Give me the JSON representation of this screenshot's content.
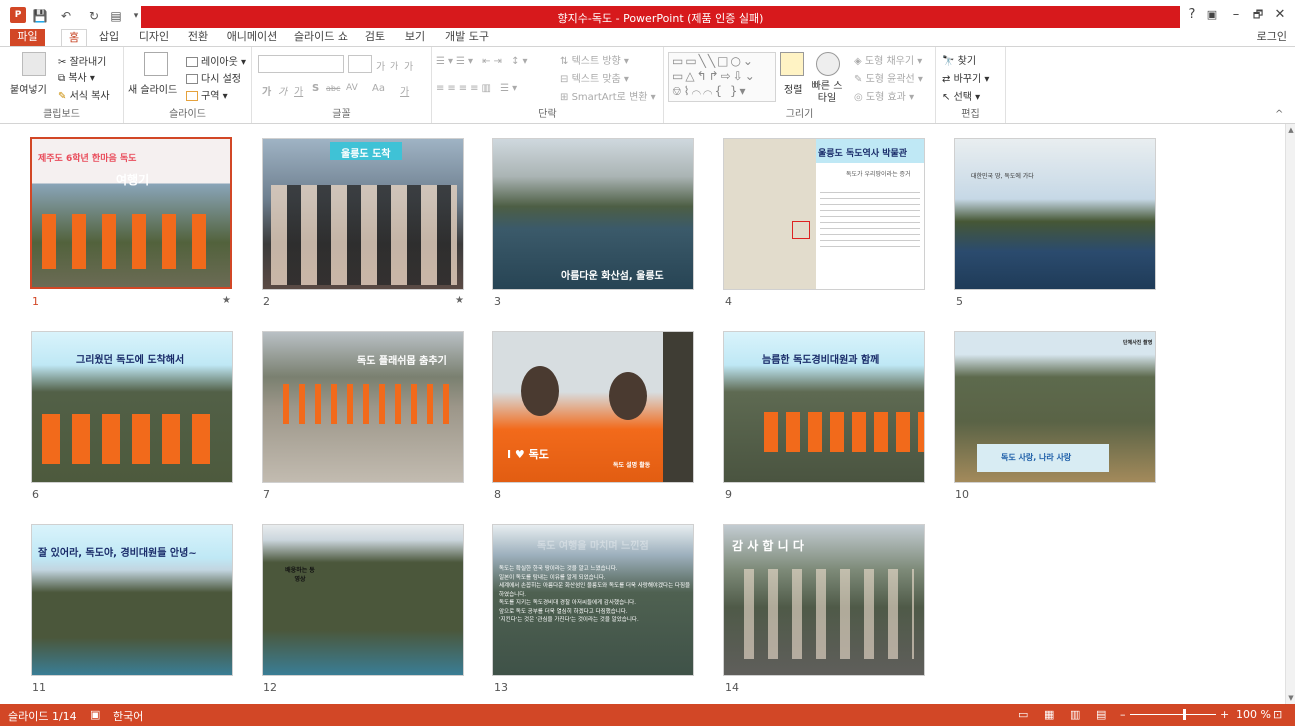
{
  "window": {
    "title": "향지수-독도 - PowerPoint (제품 인증 실패)",
    "help": "?",
    "ribbon_display": "▣",
    "minimize": "–",
    "restore": "🗗",
    "close": "✕"
  },
  "tabs": {
    "file": "파일",
    "home": "홈",
    "insert": "삽입",
    "design": "디자인",
    "transitions": "전환",
    "animations": "애니메이션",
    "slideshow": "슬라이드 쇼",
    "review": "검토",
    "view": "보기",
    "developer": "개발 도구",
    "login": "로그인"
  },
  "ribbon": {
    "clipboard": {
      "paste": "붙여넣기",
      "cut": "잘라내기",
      "copy": "복사",
      "format_painter": "서식 복사",
      "label": "클립보드"
    },
    "slides": {
      "new_slide": "새 슬라이드",
      "layout": "레이아웃",
      "reset": "다시 설정",
      "section": "구역",
      "label": "슬라이드"
    },
    "font": {
      "font_label": "글꼴",
      "inc": "가",
      "dec": "가",
      "clear": "가",
      "bold": "가",
      "italic": "가",
      "underline": "가",
      "shadow": "S",
      "strike": "abc",
      "spacing": "AV",
      "case": "Aa",
      "color": "가"
    },
    "paragraph": {
      "label": "단락",
      "text_direction": "텍스트 방향",
      "align_text": "텍스트 맞춤",
      "smartart": "SmartArt로 변환"
    },
    "drawing": {
      "label": "그리기",
      "arrange": "정렬",
      "quick_styles": "빠른 스타일",
      "shape_fill": "도형 채우기",
      "shape_outline": "도형 윤곽선",
      "shape_effects": "도형 효과"
    },
    "editing": {
      "label": "편집",
      "find": "찾기",
      "replace": "바꾸기",
      "select": "선택"
    }
  },
  "slides": [
    {
      "num": "1",
      "title1": "제주도 6학년 한마음 독도",
      "title2": "여행기",
      "star": "★"
    },
    {
      "num": "2",
      "title": "울릉도 도착",
      "star": "★"
    },
    {
      "num": "3",
      "title": "아름다운 화산섬, 울릉도"
    },
    {
      "num": "4",
      "title": "울릉도 독도역사 박물관",
      "sub": "독도가 우리땅이라는 증거"
    },
    {
      "num": "5",
      "title": "대한민국 땅, 독도에 가다"
    },
    {
      "num": "6",
      "title": "그리웠던 독도에 도착해서"
    },
    {
      "num": "7",
      "title": "독도 플래쉬몹 춤추기"
    },
    {
      "num": "8",
      "title": "독도 설명 활동",
      "shirt": "I ♥ 독도"
    },
    {
      "num": "9",
      "title": "늠름한 독도경비대원과 함께"
    },
    {
      "num": "10",
      "title": "단체사진 촬영",
      "banner": "독도 사랑, 나라 사랑"
    },
    {
      "num": "11",
      "title": "잘 있어라, 독도야, 경비대원들 안녕~"
    },
    {
      "num": "12",
      "title": "배웅하는 동영상"
    },
    {
      "num": "13",
      "title": "독도 여행을 마치며 느낀점",
      "bullets": [
        "독도는 확실한 한국 땅이라는 것을 알고 느꼈습니다.",
        "일본이 독도를 탐내는 이유를 알게 되었습니다.",
        "세계에서 손꼽히는 아름다운 화산섬인 울릉도와 독도를 더욱 사랑해야겠다는 다짐을 하였습니다.",
        "독도를 지키는 독도경비대 경찰 아저씨들에게 감사했습니다.",
        "앞으로 독도 공부를 더욱 열심히 하겠다고 다짐했습니다.",
        "'지킨다'는 것은 '관심을 가진다'는 것이라는 것을 알았습니다."
      ]
    },
    {
      "num": "14",
      "title": "감 사 합 니 다"
    }
  ],
  "status": {
    "slide_info": "슬라이드 1/14",
    "language": "한국어",
    "zoom": "100 %"
  },
  "colors": {
    "accent": "#d24726",
    "title_red": "#d7191c",
    "sky": "#9ec9e6",
    "sea": "#356a8c",
    "rock": "#4e5a3e",
    "orange_shirt": "#f26a1b"
  }
}
